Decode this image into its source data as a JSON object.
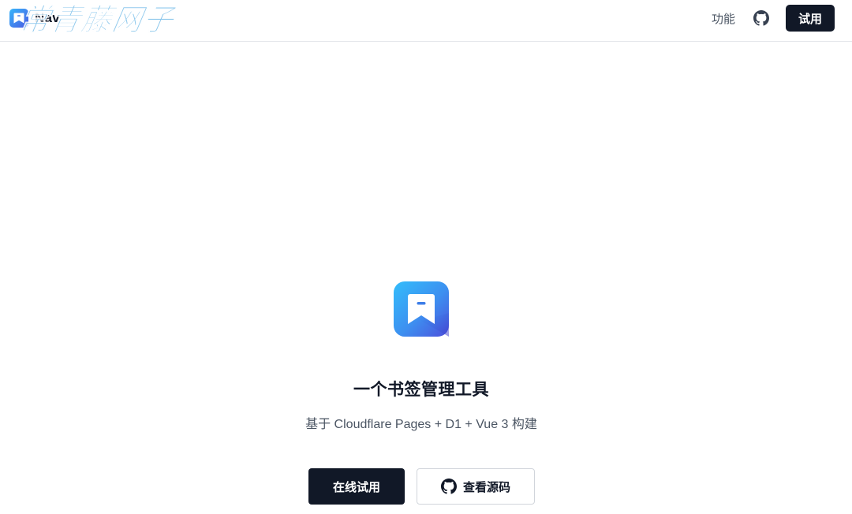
{
  "header": {
    "brand_name": "Nav",
    "watermark": "常青藤网子",
    "nav_features": "功能",
    "nav_try": "试用",
    "github_icon": "github-icon"
  },
  "hero": {
    "logo_icon": "bookmark-app-icon",
    "title": "一个书签管理工具",
    "subtitle": "基于 Cloudflare Pages + D1 + Vue 3 构建",
    "primary_cta": "在线试用",
    "secondary_cta": "查看源码",
    "secondary_icon": "github-icon"
  },
  "colors": {
    "primary_dark": "#111827",
    "logo_gradient_start": "#3ab0f7",
    "logo_gradient_end": "#4a57e0",
    "watermark": "#7cc0ea",
    "border": "#e5e7eb"
  }
}
